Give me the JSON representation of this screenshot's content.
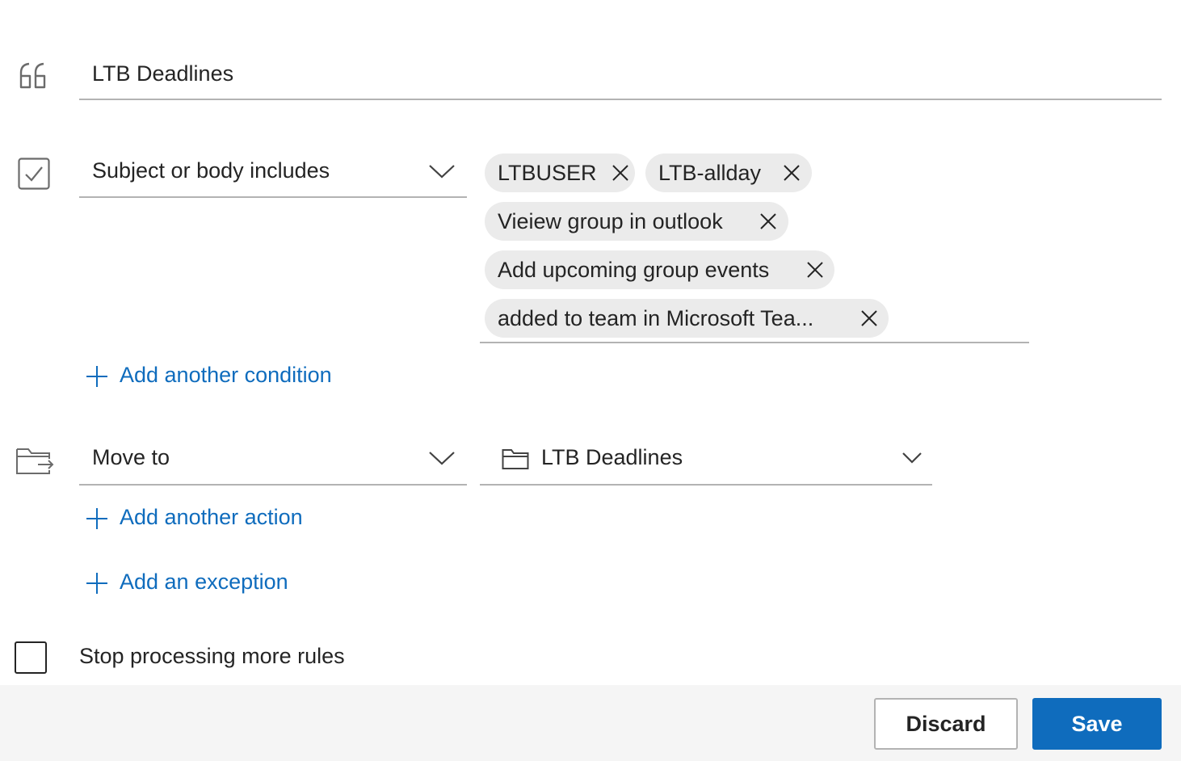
{
  "rule_name": {
    "value": "LTB Deadlines",
    "icon": "quote-icon"
  },
  "condition": {
    "icon": "checkbox-checked-icon",
    "type_label": "Subject or body includes",
    "chips": [
      {
        "label": "LTBUSER"
      },
      {
        "label": "LTB-allday"
      },
      {
        "label": "Vieiew group in outlook"
      },
      {
        "label": "Add upcoming group events"
      },
      {
        "label": "added to team in Microsoft Tea..."
      }
    ],
    "add_label": "Add another condition"
  },
  "action": {
    "icon": "move-to-folder-icon",
    "type_label": "Move to",
    "folder_label": "LTB Deadlines",
    "add_label": "Add another action"
  },
  "exception": {
    "add_label": "Add an exception"
  },
  "stop_processing": {
    "label": "Stop processing more rules",
    "checked": false
  },
  "footer": {
    "discard_label": "Discard",
    "save_label": "Save"
  },
  "colors": {
    "accent": "#0f6cbd",
    "chip_bg": "#ebebeb",
    "footer_bg": "#f5f5f5"
  }
}
